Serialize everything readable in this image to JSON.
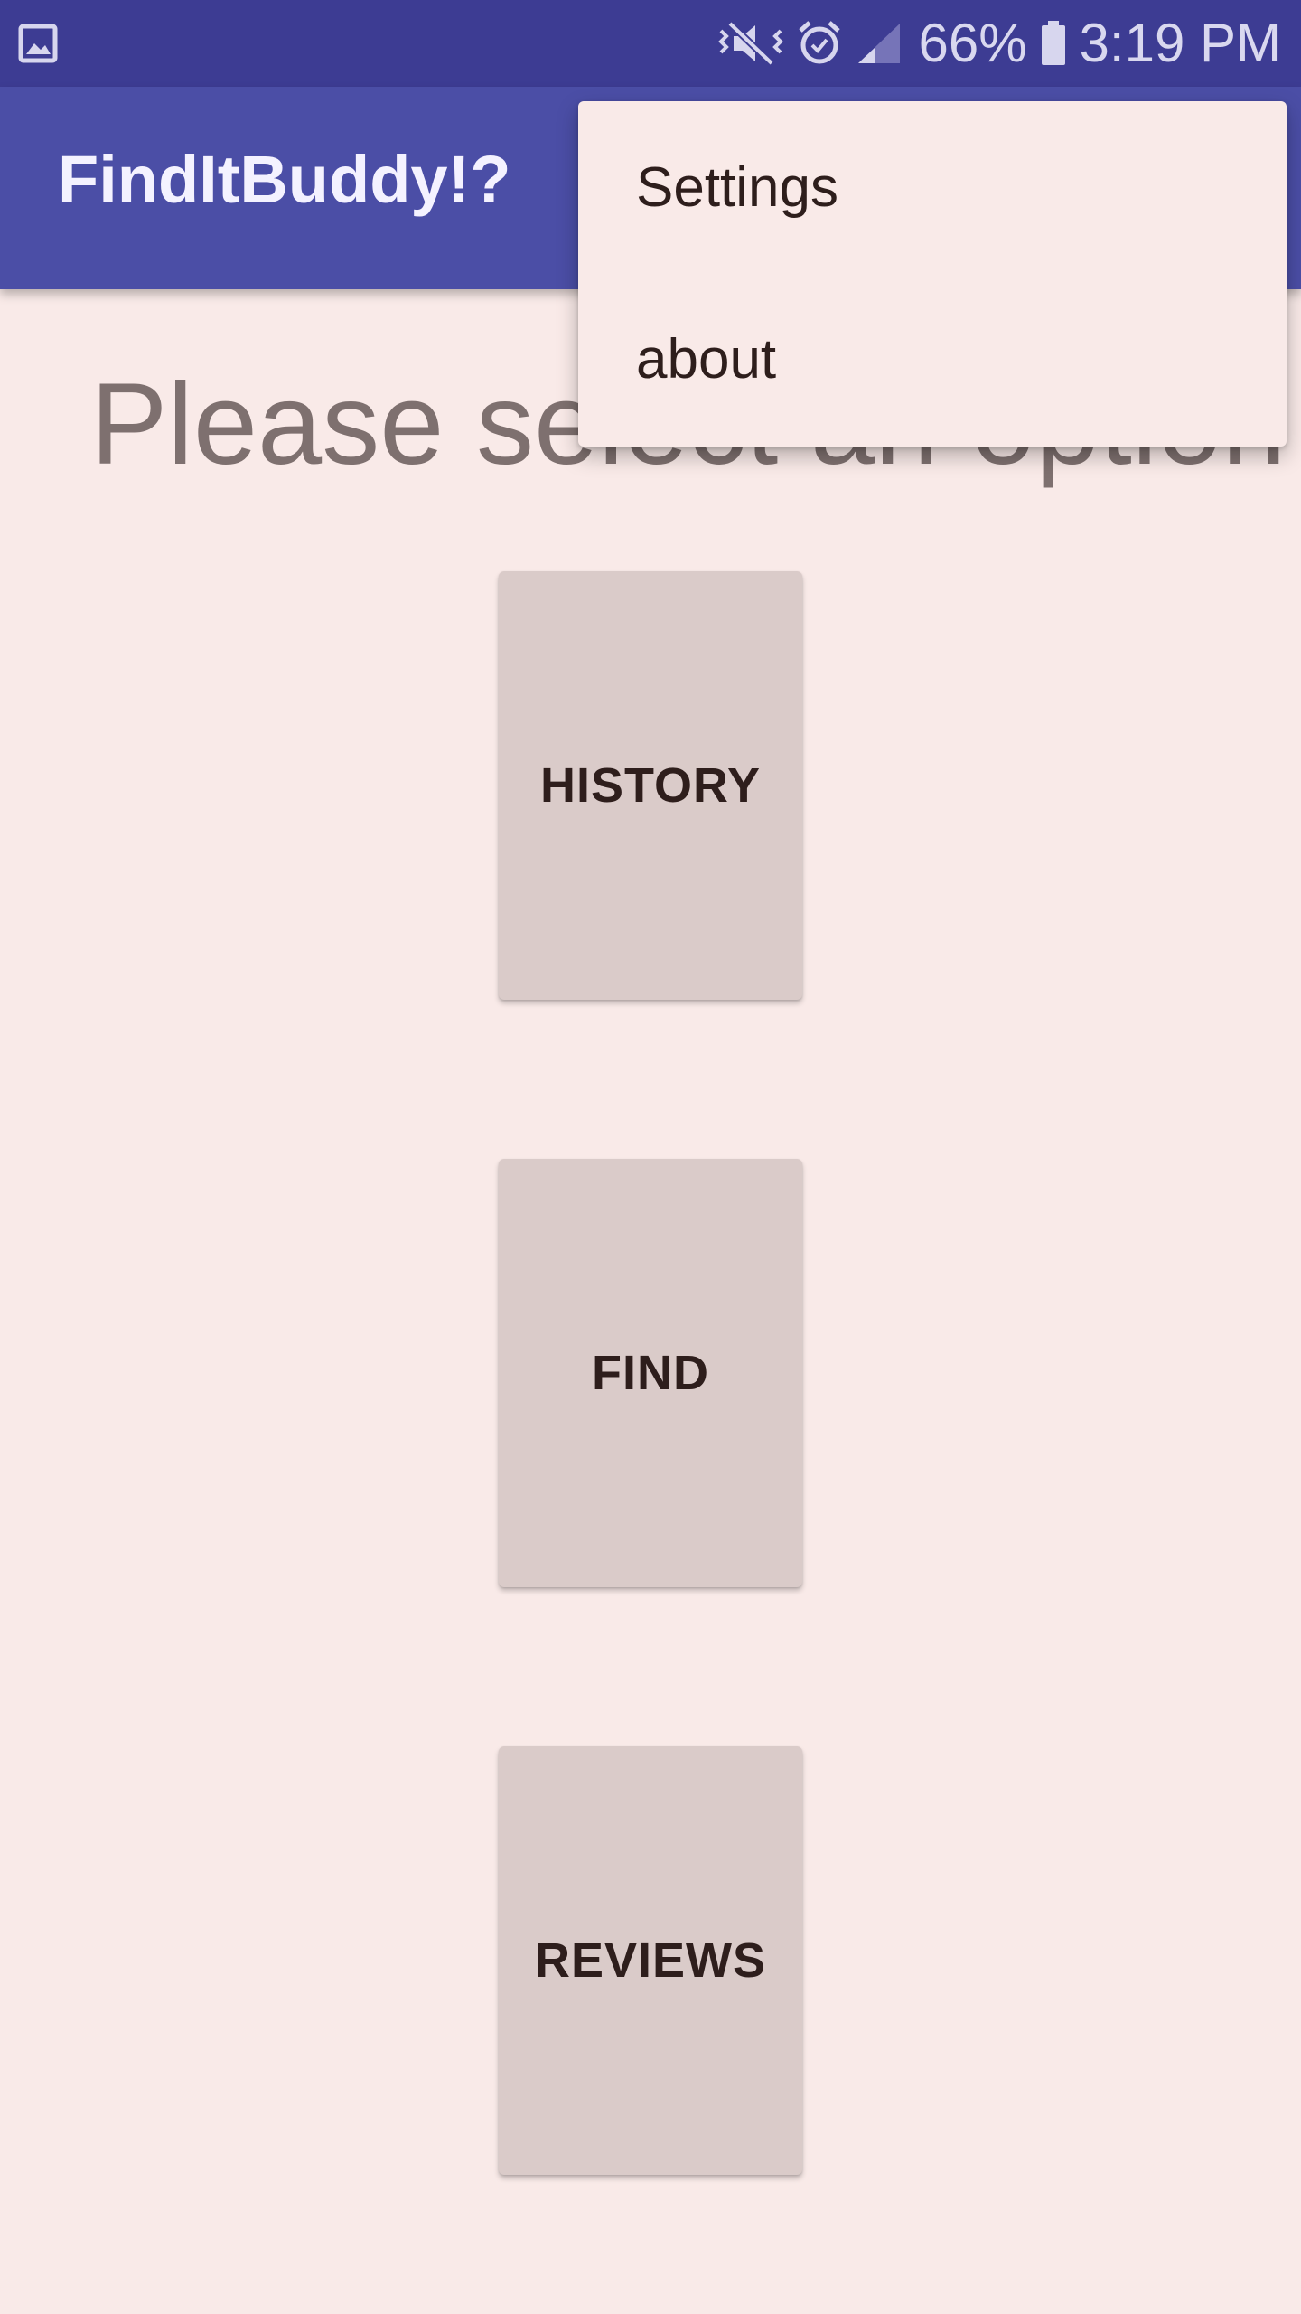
{
  "status_bar": {
    "battery": "66%",
    "time": "3:19 PM",
    "icons": [
      "gallery-icon",
      "mute-vibrate-icon",
      "alarm-icon",
      "signal-icon",
      "battery-icon"
    ]
  },
  "app_bar": {
    "title": "FindItBuddy!?"
  },
  "main": {
    "heading": "Please select an option",
    "buttons": [
      {
        "label": "HISTORY"
      },
      {
        "label": "FIND"
      },
      {
        "label": "REVIEWS"
      }
    ]
  },
  "overflow_menu": {
    "items": [
      {
        "label": "Settings"
      },
      {
        "label": "about"
      }
    ]
  },
  "colors": {
    "status_bar": "#3d3c93",
    "app_bar": "#4b4ea6",
    "background": "#f9eae8",
    "button": "#dacbc9",
    "text_dark": "#2e1e1c",
    "heading_text": "#7e706f"
  }
}
